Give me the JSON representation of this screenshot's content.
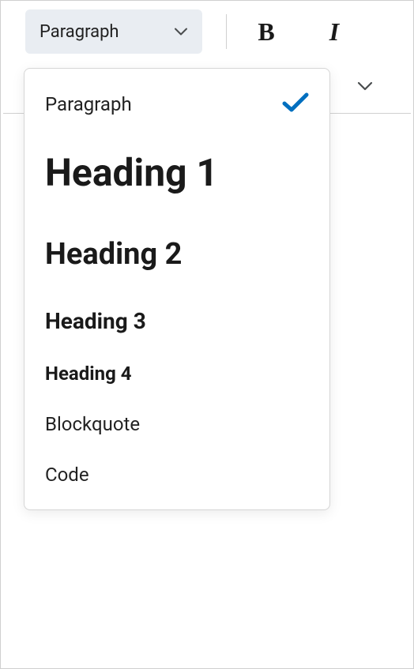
{
  "toolbar": {
    "format_selector": {
      "current": "Paragraph"
    },
    "bold_letter": "B",
    "italic_letter": "I"
  },
  "dropdown": {
    "items": [
      {
        "label": "Paragraph",
        "selected": true,
        "style_class": "item-paragraph"
      },
      {
        "label": "Heading 1",
        "selected": false,
        "style_class": "item-heading1"
      },
      {
        "label": "Heading 2",
        "selected": false,
        "style_class": "item-heading2"
      },
      {
        "label": "Heading 3",
        "selected": false,
        "style_class": "item-heading3"
      },
      {
        "label": "Heading 4",
        "selected": false,
        "style_class": "item-heading4"
      },
      {
        "label": "Blockquote",
        "selected": false,
        "style_class": "item-blockquote"
      },
      {
        "label": "Code",
        "selected": false,
        "style_class": "item-code"
      }
    ]
  },
  "colors": {
    "accent": "#006fbf",
    "selector_bg": "#e9edf2",
    "border": "#d0d0d0"
  }
}
